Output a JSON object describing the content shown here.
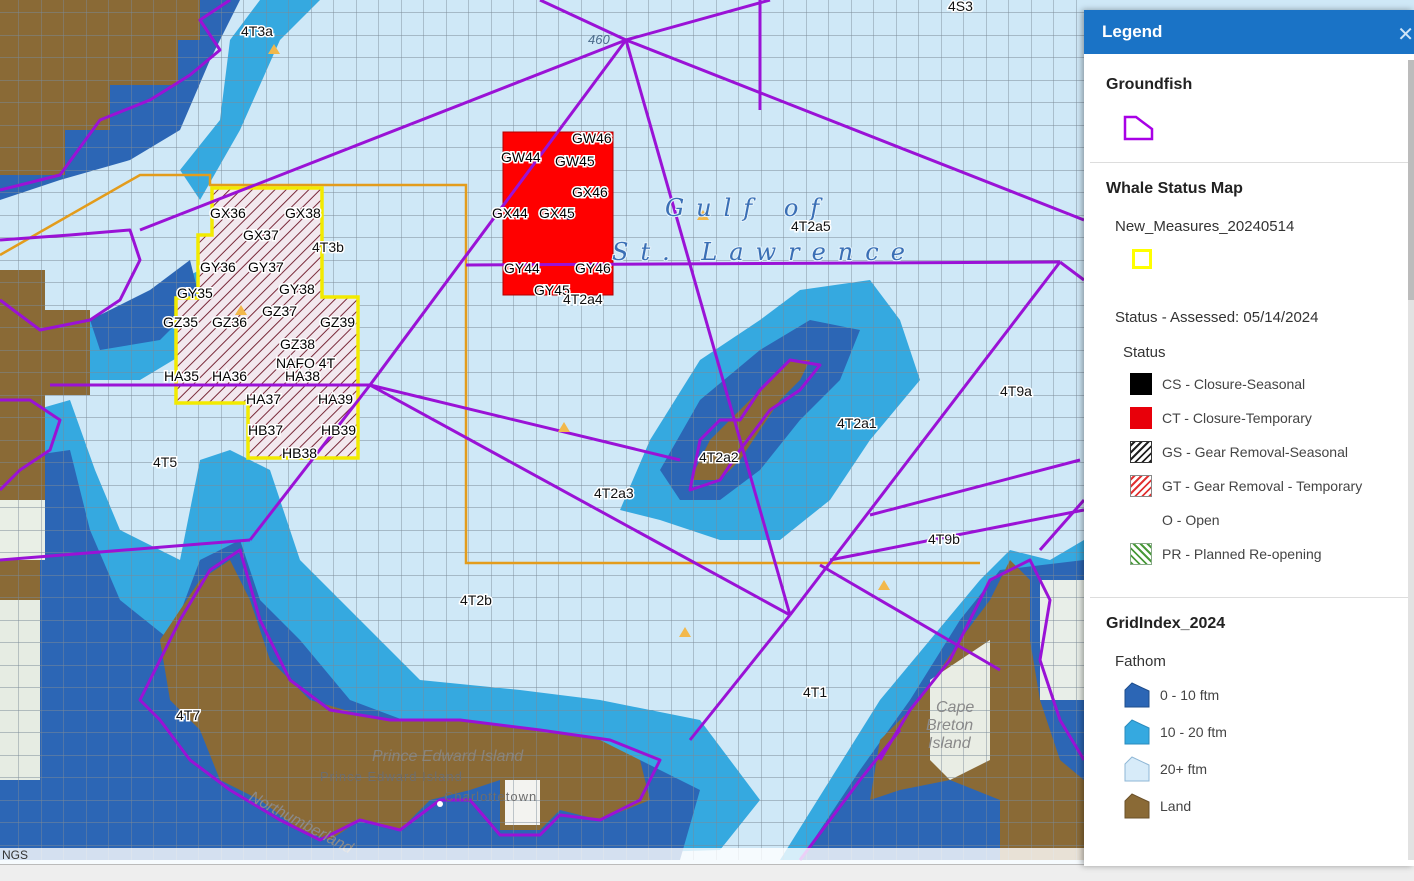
{
  "map": {
    "attribution": "NGS",
    "sea_label_line1": "Gulf of",
    "sea_label_line2": "St. Lawrence",
    "depth_contour_label": "460",
    "place_labels": [
      "Prince Edward Island",
      "Prince Edward Island",
      "Charlottetown",
      "Cape",
      "Breton",
      "Island",
      "Northumberland"
    ],
    "grid_cell_labels": [
      "GW46",
      "GW44",
      "GW45",
      "GX46",
      "GX44",
      "GX45",
      "GY44",
      "GY46",
      "GY45",
      "GX36",
      "GX38",
      "GX37",
      "GY36",
      "GY37",
      "GY35",
      "GY38",
      "GZ35",
      "GZ36",
      "GZ37",
      "GZ39",
      "GZ38",
      "HA35",
      "HA36",
      "HA38",
      "HA37",
      "HA39",
      "HB37",
      "HB39",
      "HB38",
      "NAFO 4T"
    ],
    "area_labels": [
      "4T3a",
      "4S3",
      "4T2a5",
      "4T3b",
      "4T2a4",
      "4T9a",
      "4T2a1",
      "4T2a2",
      "4T5",
      "4T2a3",
      "4T9b",
      "4T2b",
      "4T1",
      "4T7"
    ],
    "colors": {
      "deep_sea": "#cfe8f7",
      "mid_depth": "#35a9e0",
      "shallow": "#2c66b5",
      "land": "#8a6a36",
      "grid": "#7b8a97",
      "groundfish": "#9a12d6",
      "new_measures": "#f2ea00",
      "gridindex_outline": "#e39c1c",
      "closure_temp": "#ff0000"
    }
  },
  "legend": {
    "title": "Legend",
    "close_icon": "close-icon",
    "groundfish": {
      "title": "Groundfish",
      "symbol_color": "#a800e6"
    },
    "whale": {
      "title": "Whale Status Map",
      "layer_name": "New_Measures_20240514",
      "layer_symbol_color": "#ffff00",
      "assessed": "Status - Assessed: 05/14/2024",
      "status_title": "Status",
      "items": [
        {
          "label": "CS - Closure-Seasonal",
          "swatch": "black"
        },
        {
          "label": "CT - Closure-Temporary",
          "swatch": "red"
        },
        {
          "label": "GS - Gear Removal-Seasonal",
          "swatch": "hatch-black"
        },
        {
          "label": "GT - Gear Removal - Temporary",
          "swatch": "hatch-red"
        },
        {
          "label": "O - Open",
          "swatch": "none"
        },
        {
          "label": "PR - Planned Re-opening",
          "swatch": "hatch-green"
        }
      ]
    },
    "gridindex": {
      "title": "GridIndex_2024",
      "fathom_title": "Fathom",
      "items": [
        {
          "label": "0 - 10 ftm",
          "color": "#2c66b5"
        },
        {
          "label": "10 - 20 ftm",
          "color": "#35a9e0"
        },
        {
          "label": "20+ ftm",
          "color": "#d7ebf9"
        },
        {
          "label": "Land",
          "color": "#8a6a36"
        }
      ]
    }
  }
}
